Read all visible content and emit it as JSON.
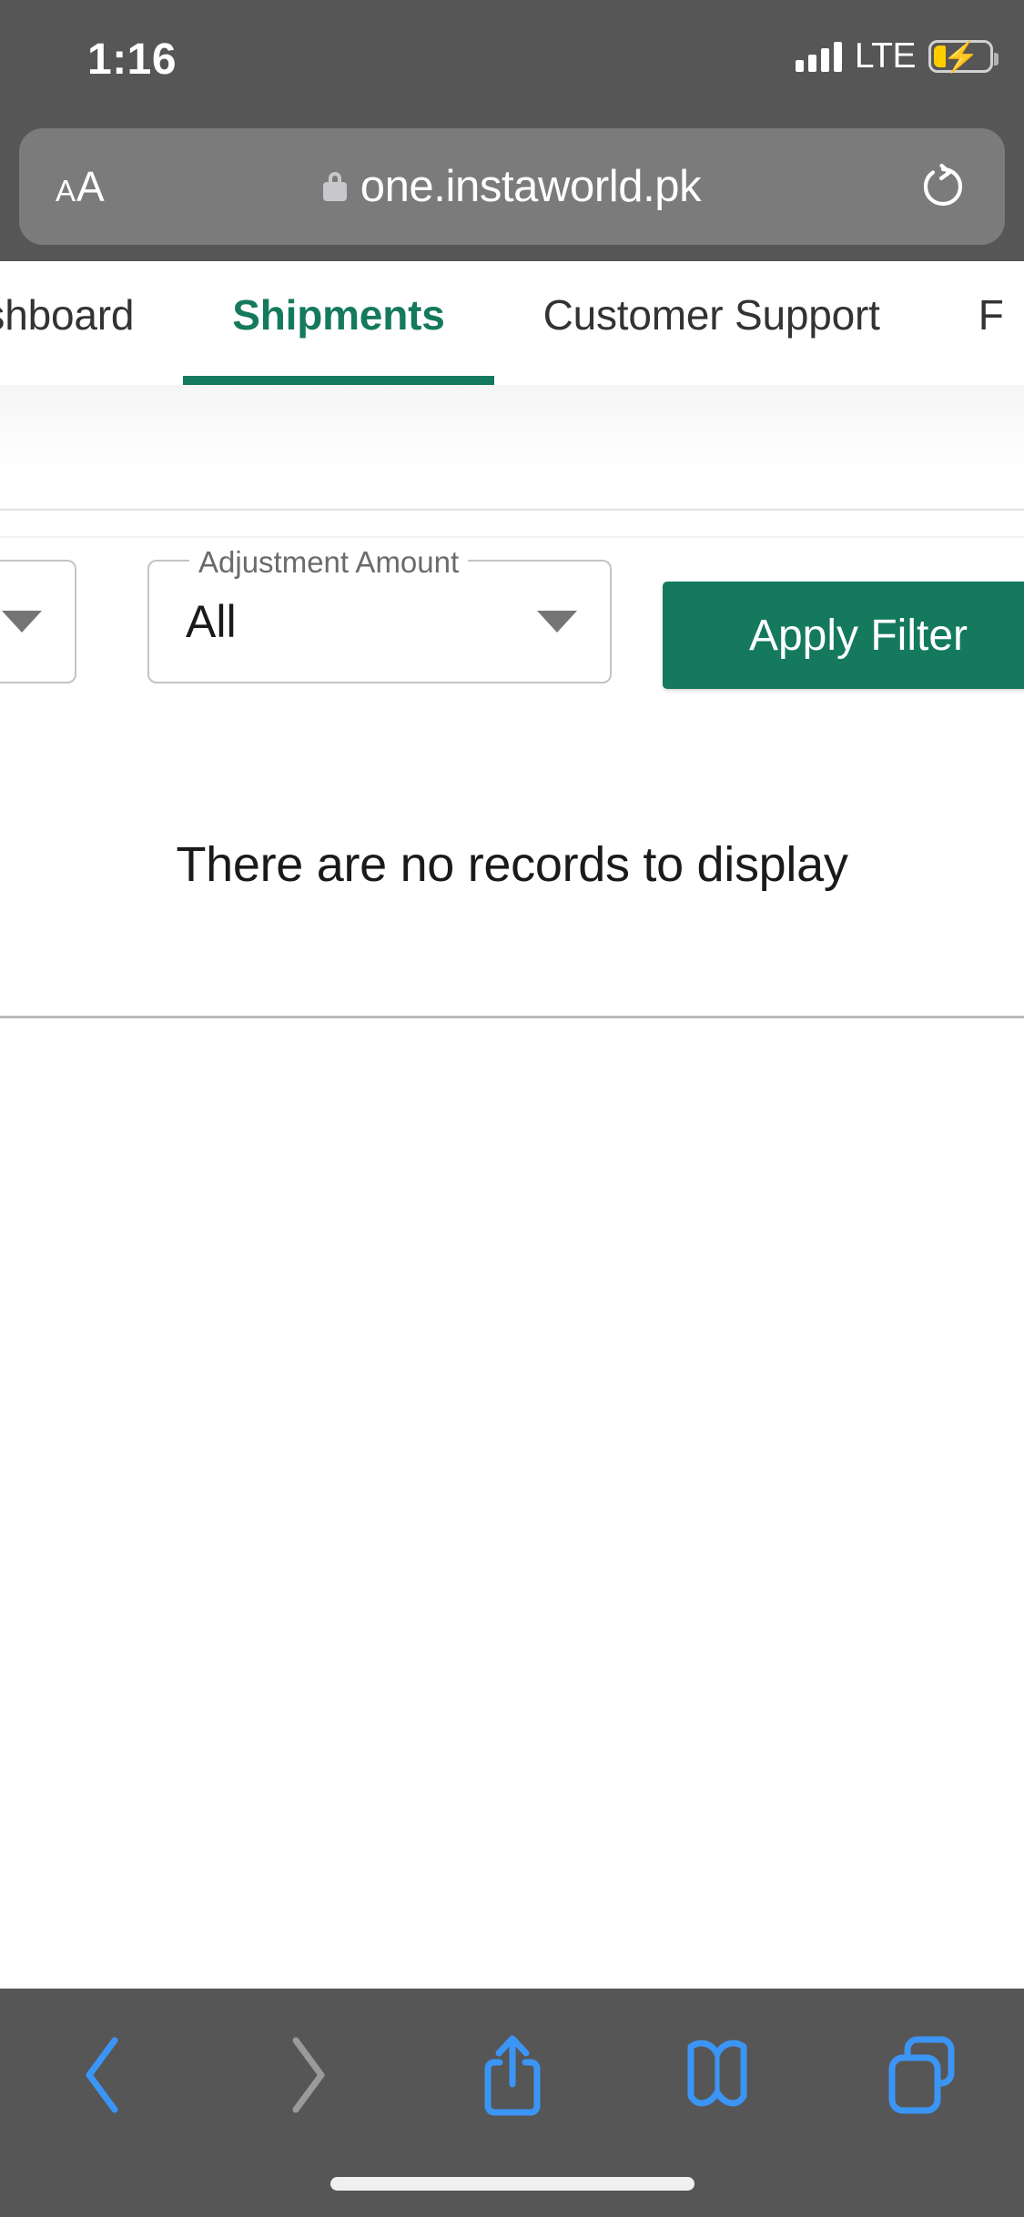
{
  "status_bar": {
    "time": "1:16",
    "network_label": "LTE",
    "signal_icon": "cellular-signal-icon",
    "battery_icon": "battery-charging-icon",
    "battery_accent": "#ffcc00"
  },
  "browser": {
    "url_bar": {
      "text_size_label_small": "A",
      "text_size_label_large": "A",
      "secure_icon": "lock-icon",
      "url": "one.instaworld.pk",
      "reload_icon": "reload-icon"
    },
    "bottom_toolbar": {
      "items": [
        {
          "name": "back-button",
          "icon": "chevron-left-icon",
          "enabled": true
        },
        {
          "name": "forward-button",
          "icon": "chevron-right-icon",
          "enabled": false
        },
        {
          "name": "share-button",
          "icon": "share-icon",
          "enabled": true
        },
        {
          "name": "bookmarks-button",
          "icon": "book-icon",
          "enabled": true
        },
        {
          "name": "tabs-button",
          "icon": "tabs-icon",
          "enabled": true
        }
      ],
      "active_color": "#3b95f5",
      "disabled_color": "#9a9a9a"
    }
  },
  "site": {
    "accent_color": "#157a5d",
    "nav_tabs": [
      {
        "label": "Dashboard",
        "active": false
      },
      {
        "label": "Shipments",
        "active": true
      },
      {
        "label": "Customer Support",
        "active": false
      },
      {
        "label": "F",
        "active": false
      }
    ],
    "filters": {
      "partial_select": {
        "value": "",
        "arrow_icon": "chevron-down-icon"
      },
      "adjustment_amount": {
        "label": "Adjustment Amount",
        "value": "All",
        "arrow_icon": "chevron-down-icon"
      },
      "apply_button_label": "Apply Filter"
    },
    "table": {
      "empty_message": "There are no records to display"
    }
  }
}
